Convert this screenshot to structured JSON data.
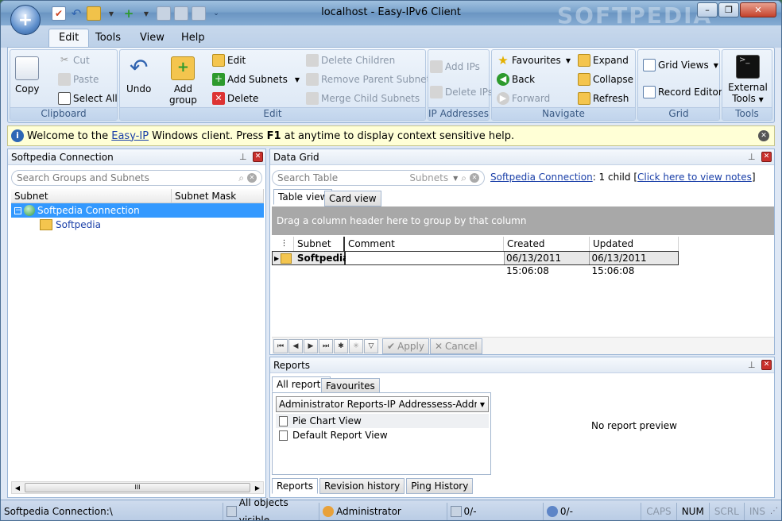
{
  "window": {
    "title": "localhost - Easy-IPv6 Client",
    "watermark": "SOFTPEDIA"
  },
  "ribbon_tabs": [
    "Edit",
    "Tools",
    "View",
    "Help"
  ],
  "clipboard": {
    "label": "Clipboard",
    "copy": "Copy",
    "cut": "Cut",
    "paste": "Paste",
    "select_all": "Select All"
  },
  "edit_group": {
    "label": "Edit",
    "undo": "Undo",
    "add_group_1": "Add",
    "add_group_2": "group",
    "edit": "Edit",
    "add_subnets": "Add Subnets",
    "delete": "Delete",
    "delete_children": "Delete Children",
    "remove_parent": "Remove Parent Subnet",
    "merge_child": "Merge Child Subnets"
  },
  "ip_group": {
    "label": "IP Addresses",
    "add_ips": "Add IPs",
    "delete_ips": "Delete IPs"
  },
  "navigate": {
    "label": "Navigate",
    "favourites": "Favourites",
    "back": "Back",
    "forward": "Forward",
    "expand": "Expand",
    "collapse": "Collapse",
    "refresh": "Refresh"
  },
  "grid": {
    "label": "Grid",
    "grid_views": "Grid Views",
    "record_editor": "Record Editor"
  },
  "tools": {
    "label": "Tools",
    "external_1": "External",
    "external_2": "Tools"
  },
  "infobar": {
    "pre": "Welcome to the ",
    "link": "Easy-IP",
    "mid": " Windows client. Press ",
    "key": "F1",
    "post": " at anytime to display context sensitive help."
  },
  "left_panel": {
    "title": "Softpedia Connection",
    "search_placeholder": "Search Groups and Subnets",
    "col_subnet": "Subnet",
    "col_mask": "Subnet Mask",
    "tree": [
      {
        "label": "Softpedia Connection"
      },
      {
        "label": "Softpedia"
      }
    ],
    "hscroll": "III"
  },
  "data_grid": {
    "title": "Data Grid",
    "search_placeholder": "Search Table",
    "search_scope": "Subnets",
    "conn_link": "Softpedia Connection",
    "child_text": ":  1 child [",
    "notes_link": "Click here to view notes",
    "notes_close": "]",
    "tab_table": "Table view",
    "tab_card": "Card view",
    "group_hint": "Drag a column header here to group by that column",
    "columns": [
      "Subnet",
      "Comment",
      "Created",
      "Updated"
    ],
    "rows": [
      {
        "subnet": "Softpedia",
        "comment": "",
        "created": "06/13/2011 15:06:08",
        "updated": "06/13/2011 15:06:08"
      }
    ],
    "apply": "Apply",
    "cancel": "Cancel"
  },
  "reports": {
    "title": "Reports",
    "tab_all": "All reports",
    "tab_fav": "Favourites",
    "dropdown": "Administrator Reports-IP Addressess-Addresses Typ",
    "items": [
      "Pie Chart View",
      "Default Report View"
    ],
    "preview": "No report preview",
    "bottom_tabs": [
      "Reports",
      "Revision history",
      "Ping History"
    ]
  },
  "status": {
    "path": "Softpedia Connection:\\",
    "visible": "All objects visible",
    "user": "Administrator",
    "ip1": "0/-",
    "ip2": "0/-",
    "keys": [
      "CAPS",
      "NUM",
      "SCRL",
      "INS"
    ]
  }
}
